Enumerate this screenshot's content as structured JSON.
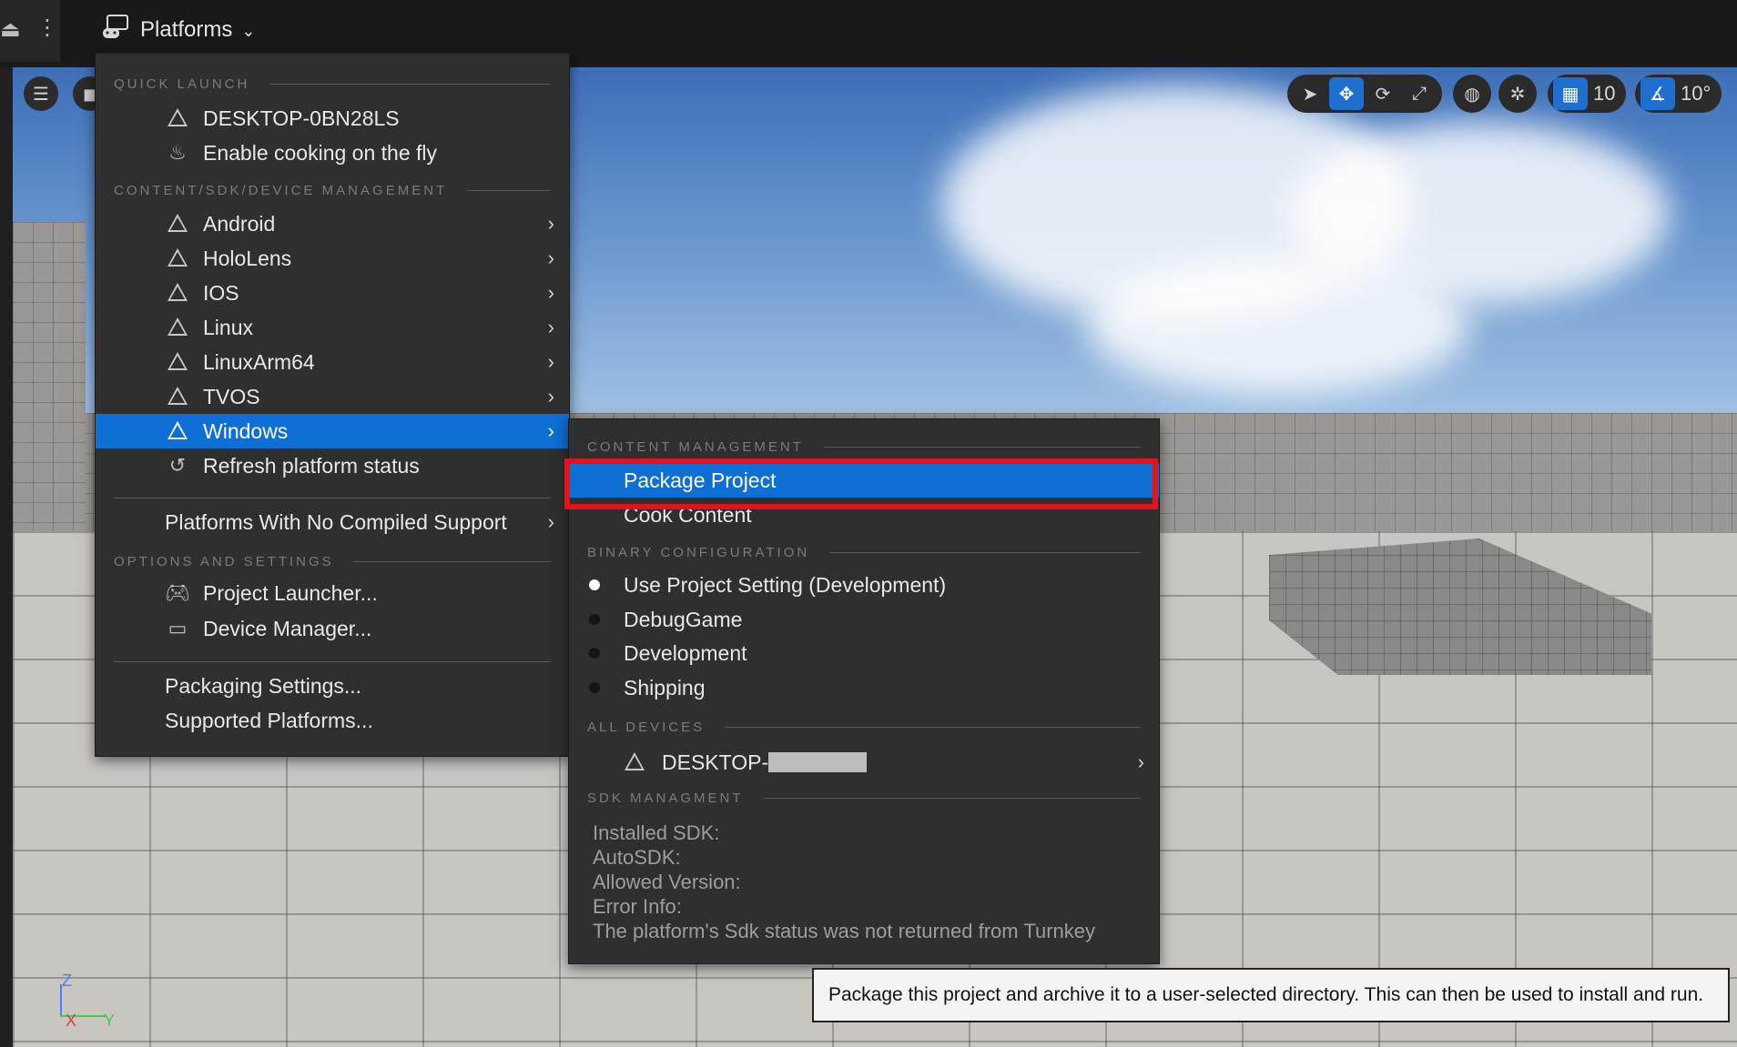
{
  "topbar": {
    "platforms_label": "Platforms"
  },
  "viewport": {
    "grid_value": "10",
    "angle_value": "10°",
    "axes": {
      "z": "Z",
      "x": "X",
      "y": "Y"
    }
  },
  "platforms_menu": {
    "quick_launch_header": "QUICK LAUNCH",
    "quick_launch": [
      {
        "label": "DESKTOP-0BN28LS",
        "icon": "warning-icon"
      },
      {
        "label": "Enable cooking on the fly",
        "icon": "cooking-icon"
      }
    ],
    "content_header": "CONTENT/SDK/DEVICE MANAGEMENT",
    "platforms": [
      {
        "label": "Android"
      },
      {
        "label": "HoloLens"
      },
      {
        "label": "IOS"
      },
      {
        "label": "Linux"
      },
      {
        "label": "LinuxArm64"
      },
      {
        "label": "TVOS"
      },
      {
        "label": "Windows"
      }
    ],
    "refresh_label": "Refresh platform status",
    "no_support_label": "Platforms With No Compiled Support",
    "options_header": "OPTIONS AND SETTINGS",
    "project_launcher_label": "Project Launcher...",
    "device_manager_label": "Device Manager...",
    "packaging_settings_label": "Packaging Settings...",
    "supported_platforms_label": "Supported Platforms..."
  },
  "windows_submenu": {
    "content_header": "CONTENT MANAGEMENT",
    "package_project_label": "Package Project",
    "cook_content_label": "Cook Content",
    "binary_header": "BINARY CONFIGURATION",
    "binary_options": [
      {
        "label": "Use Project Setting (Development)",
        "selected": true
      },
      {
        "label": "DebugGame",
        "selected": false
      },
      {
        "label": "Development",
        "selected": false
      },
      {
        "label": "Shipping",
        "selected": false
      }
    ],
    "devices_header": "ALL DEVICES",
    "device_label": "DESKTOP-",
    "sdk_header": "SDK MANAGMENT",
    "sdk_lines": [
      "Installed SDK:",
      "AutoSDK:",
      "Allowed Version:",
      "Error Info:",
      "The platform's Sdk status was not returned from Turnkey"
    ]
  },
  "tooltip": {
    "text": "Package this project and archive it to a user-selected directory. This can then be used to install and run."
  },
  "colors": {
    "highlight": "#0e6fd4",
    "annotation_box": "#e3131b",
    "menu_bg": "#2f2f2f"
  }
}
